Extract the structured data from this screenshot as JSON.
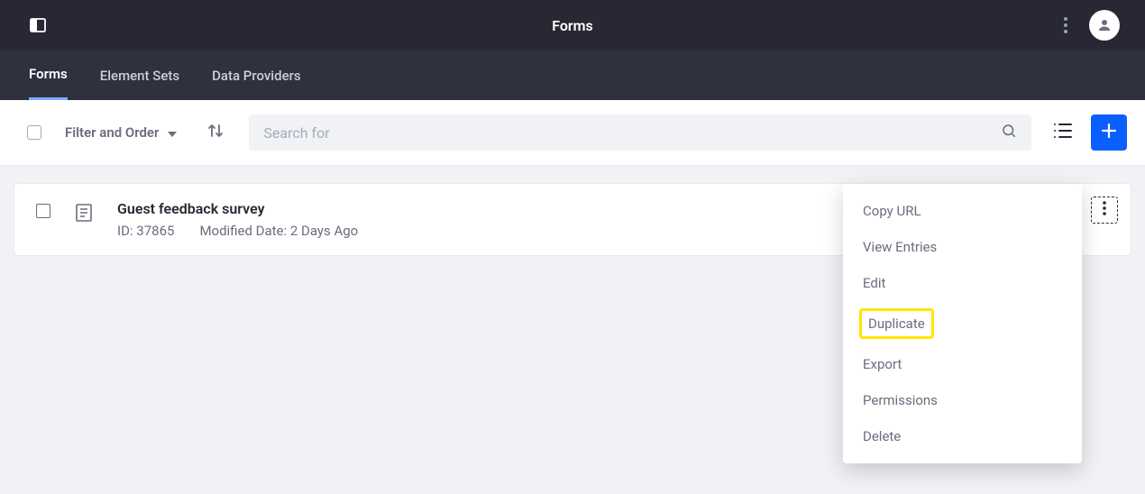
{
  "header": {
    "title": "Forms"
  },
  "tabs": [
    {
      "label": "Forms",
      "active": true
    },
    {
      "label": "Element Sets",
      "active": false
    },
    {
      "label": "Data Providers",
      "active": false
    }
  ],
  "toolbar": {
    "filter_label": "Filter and Order",
    "search_placeholder": "Search for"
  },
  "row": {
    "title": "Guest feedback survey",
    "id_label": "ID: 37865",
    "modified_label": "Modified Date: 2 Days Ago"
  },
  "menu": {
    "items": [
      "Copy URL",
      "View Entries",
      "Edit",
      "Duplicate",
      "Export",
      "Permissions",
      "Delete"
    ],
    "highlighted_index": 3
  }
}
